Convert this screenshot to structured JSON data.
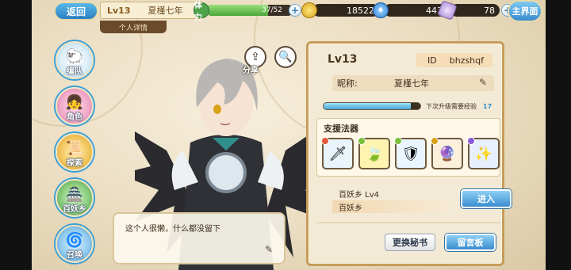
{
  "topbar": {
    "back_label": "返回",
    "level": "Lv13",
    "player_name": "夏槿七年",
    "stamina_icon_label": "体力",
    "stamina_text": "37/52",
    "stamina_ratio": 0.71,
    "coin_value": "18522",
    "gem_value": "443",
    "crystal_value": "78",
    "home_label": "主界面",
    "tab_label": "个人详情"
  },
  "sidenav": [
    {
      "label": "编队",
      "icon": "team-icon"
    },
    {
      "label": "角色",
      "icon": "role-icon"
    },
    {
      "label": "探索",
      "icon": "explore-icon"
    },
    {
      "label": "百妖乡",
      "icon": "village-icon"
    },
    {
      "label": "召唤",
      "icon": "summon-icon"
    }
  ],
  "character": {
    "share_label": "分享",
    "bio": "这个人很懒，什么都没留下"
  },
  "panel": {
    "level": "Lv13",
    "id_label": "ID",
    "id_value": "bhzshqf",
    "nickname_label": "昵称:",
    "nickname_value": "夏槿七年",
    "exp_ratio": 0.9,
    "exp_label": "下次升级需要经验",
    "exp_value": "17",
    "support_title": "支援法器",
    "artifacts": [
      {
        "icon": "dagger-artifact-icon",
        "rarity_color": "#e25a3a"
      },
      {
        "icon": "leaf-artifact-icon",
        "rarity_color": "#7bbf3a"
      },
      {
        "icon": "armor-artifact-icon",
        "rarity_color": "#7bbf3a"
      },
      {
        "icon": "orb-artifact-icon",
        "rarity_color": "#d9a21a"
      },
      {
        "icon": "staff-artifact-icon",
        "rarity_color": "#8a5ad6"
      }
    ],
    "village_title": "百妖乡  Lv4",
    "village_name": "百妖乡",
    "enter_label": "进入",
    "secretary_label": "更换秘书",
    "board_label": "留言板"
  }
}
